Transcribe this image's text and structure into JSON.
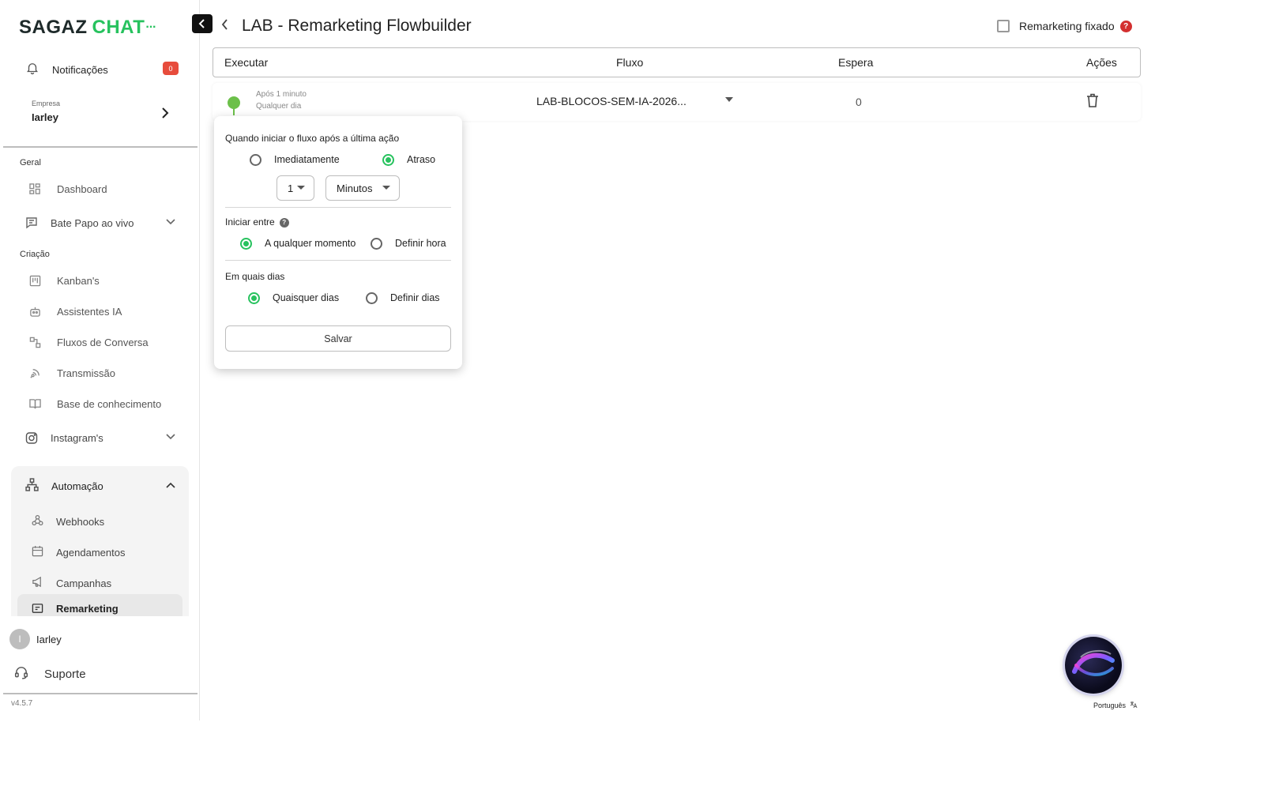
{
  "sidebar": {
    "logo": {
      "word1": "SAGAZ",
      "word2": "CHAT",
      "dots": "···"
    },
    "notifications": {
      "label": "Notificações",
      "count": "0"
    },
    "empresa": {
      "caption": "Empresa",
      "name": "Iarley"
    },
    "sections": {
      "geral": "Geral",
      "criacao": "Criação"
    },
    "items": {
      "dashboard": "Dashboard",
      "bate_papo": "Bate Papo ao vivo",
      "kanbans": "Kanban's",
      "assistentes": "Assistentes IA",
      "fluxos": "Fluxos de Conversa",
      "transmissao": "Transmissão",
      "base": "Base de conhecimento",
      "instagram": "Instagram's",
      "automacao": "Automação",
      "webhooks": "Webhooks",
      "agendamentos": "Agendamentos",
      "campanhas": "Campanhas",
      "remarketing": "Remarketing"
    },
    "user": {
      "initial": "I",
      "name": "Iarley"
    },
    "support": "Suporte",
    "version": "v4.5.7"
  },
  "header": {
    "title": "LAB - Remarketing Flowbuilder",
    "pin_label": "Remarketing fixado",
    "help": "?"
  },
  "table": {
    "columns": [
      "Executar",
      "Fluxo",
      "Espera",
      "Ações"
    ],
    "row": {
      "wait_line1": "Após 1 minuto",
      "wait_line2": "Qualquer dia",
      "flow": "LAB-BLOCOS-SEM-IA-2026...",
      "espera": "0"
    }
  },
  "popover": {
    "q1": "Quando iniciar o fluxo após a última ação",
    "opt_immediate": "Imediatamente",
    "opt_delay": "Atraso",
    "delay_value": "1",
    "delay_unit": "Minutos",
    "q2": "Iniciar entre",
    "opt_anytime": "A qualquer momento",
    "opt_settime": "Definir hora",
    "q3": "Em quais dias",
    "opt_anyday": "Quaisquer dias",
    "opt_setdays": "Definir dias",
    "save": "Salvar",
    "selected": {
      "when": "Atraso",
      "between": "A qualquer momento",
      "days": "Quaisquer dias"
    }
  },
  "language": "Português",
  "colors": {
    "accent": "#27c25e",
    "badge": "#e74c3c",
    "pin": "#6cc04a",
    "help_red": "#d32f2f"
  }
}
